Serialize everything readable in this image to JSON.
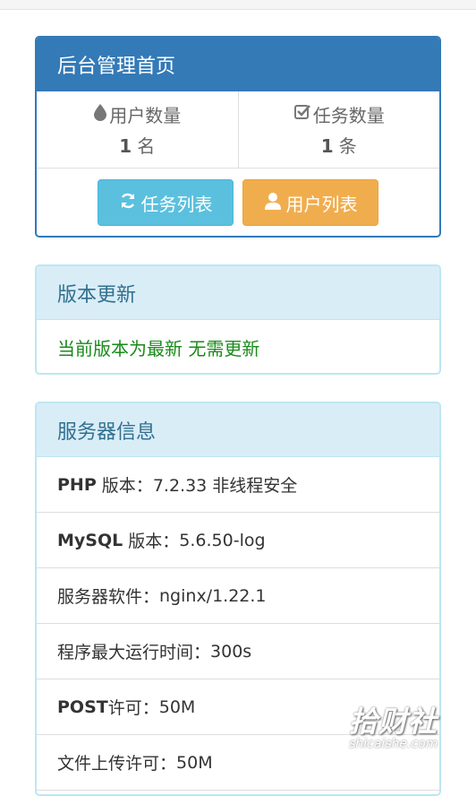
{
  "dashboard": {
    "title": "后台管理首页",
    "users": {
      "label": "用户数量",
      "count": "1",
      "unit": "名"
    },
    "tasks": {
      "label": "任务数量",
      "count": "1",
      "unit": "条"
    },
    "buttons": {
      "task_list": "任务列表",
      "user_list": "用户列表"
    }
  },
  "version": {
    "title": "版本更新",
    "message": "当前版本为最新 无需更新"
  },
  "server": {
    "title": "服务器信息",
    "rows": [
      {
        "key": "PHP",
        "label": " 版本：",
        "value": "7.2.33 非线程安全"
      },
      {
        "key": "MySQL",
        "label": " 版本：",
        "value": "5.6.50-log"
      },
      {
        "key": "",
        "label": "服务器软件：",
        "value": "nginx/1.22.1"
      },
      {
        "key": "",
        "label": "程序最大运行时间：",
        "value": "300s"
      },
      {
        "key": "POST",
        "label": "许可：",
        "value": "50M"
      },
      {
        "key": "",
        "label": "文件上传许可：",
        "value": "50M"
      }
    ]
  },
  "watermark": {
    "text": "拾财社",
    "domain": "shicaishe.com"
  },
  "colors": {
    "primary": "#337ab7",
    "info_bg": "#d9edf7",
    "btn_info": "#5bc0de",
    "btn_warning": "#f0ad4e",
    "success_text": "#1a8a1a"
  },
  "icons": [
    "tint-icon",
    "check-square-icon",
    "refresh-icon",
    "user-icon"
  ]
}
